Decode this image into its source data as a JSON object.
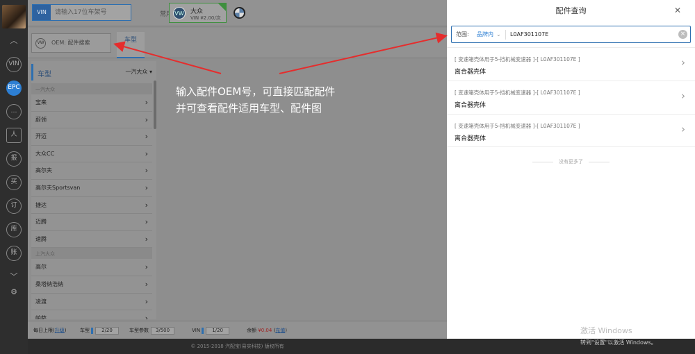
{
  "rail": {
    "buttons": [
      "VIN",
      "EPC",
      "…",
      "人",
      "报",
      "买",
      "订",
      "库",
      "账"
    ]
  },
  "topbar": {
    "vin_tag": "VIN",
    "vin_placeholder": "请输入17位车架号",
    "brand_label": "常用品牌",
    "brand_name": "大众",
    "brand_price": "VIN ¥2.00/次"
  },
  "oem": {
    "label": "OEM:",
    "placeholder": "配件搜索",
    "tab": "车型"
  },
  "sidebar": {
    "title": "车型",
    "selector": "一汽大众 ▾",
    "groups": [
      {
        "name": "一汽大众",
        "items": [
          "宝来",
          "蔚领",
          "开迈",
          "大众CC",
          "高尔夫",
          "高尔夫Sportsvan",
          "捷达",
          "迈腾",
          "速腾"
        ]
      },
      {
        "name": "上汽大众",
        "items": [
          "高尔",
          "桑塔纳浩纳",
          "凌渡",
          "帕萨"
        ]
      }
    ]
  },
  "annotation": {
    "line1": "输入配件OEM号，可直接匹配配件",
    "line2": "并可查看配件适用车型、配件图"
  },
  "status": {
    "daily_label": "每日上限",
    "daily_link": "升级",
    "model_label": "车型",
    "model_value": "2/20",
    "params_label": "车型参数",
    "params_value": "3/500",
    "vin_label": "VIN",
    "vin_value": "1/20",
    "balance_label": "余额",
    "balance_value": "¥0.04",
    "recharge_link": "充值"
  },
  "footer": "© 2015-2018 汽配宝(易实科技) 版权所有",
  "panel": {
    "title": "配件查询",
    "scope_label": "范围:",
    "scope_value": "品牌内",
    "query": "L0AF301107E",
    "results": [
      {
        "sub": "[ 变速箱壳体用于5-挡机械变速器 ]-[ L0AF301107E ]",
        "name": "离合器壳体"
      },
      {
        "sub": "[ 变速箱壳体用于5-挡机械变速器 ]-[ L0AF301107E ]",
        "name": "离合器壳体"
      },
      {
        "sub": "[ 变速箱壳体用于5-挡机械变速器 ]-[ L0AF301107E ]",
        "name": "离合器壳体"
      }
    ],
    "no_more": "没有更多了"
  },
  "watermark": {
    "line1": "激活 Windows",
    "line2": "转到\"设置\"以激活 Windows。"
  }
}
